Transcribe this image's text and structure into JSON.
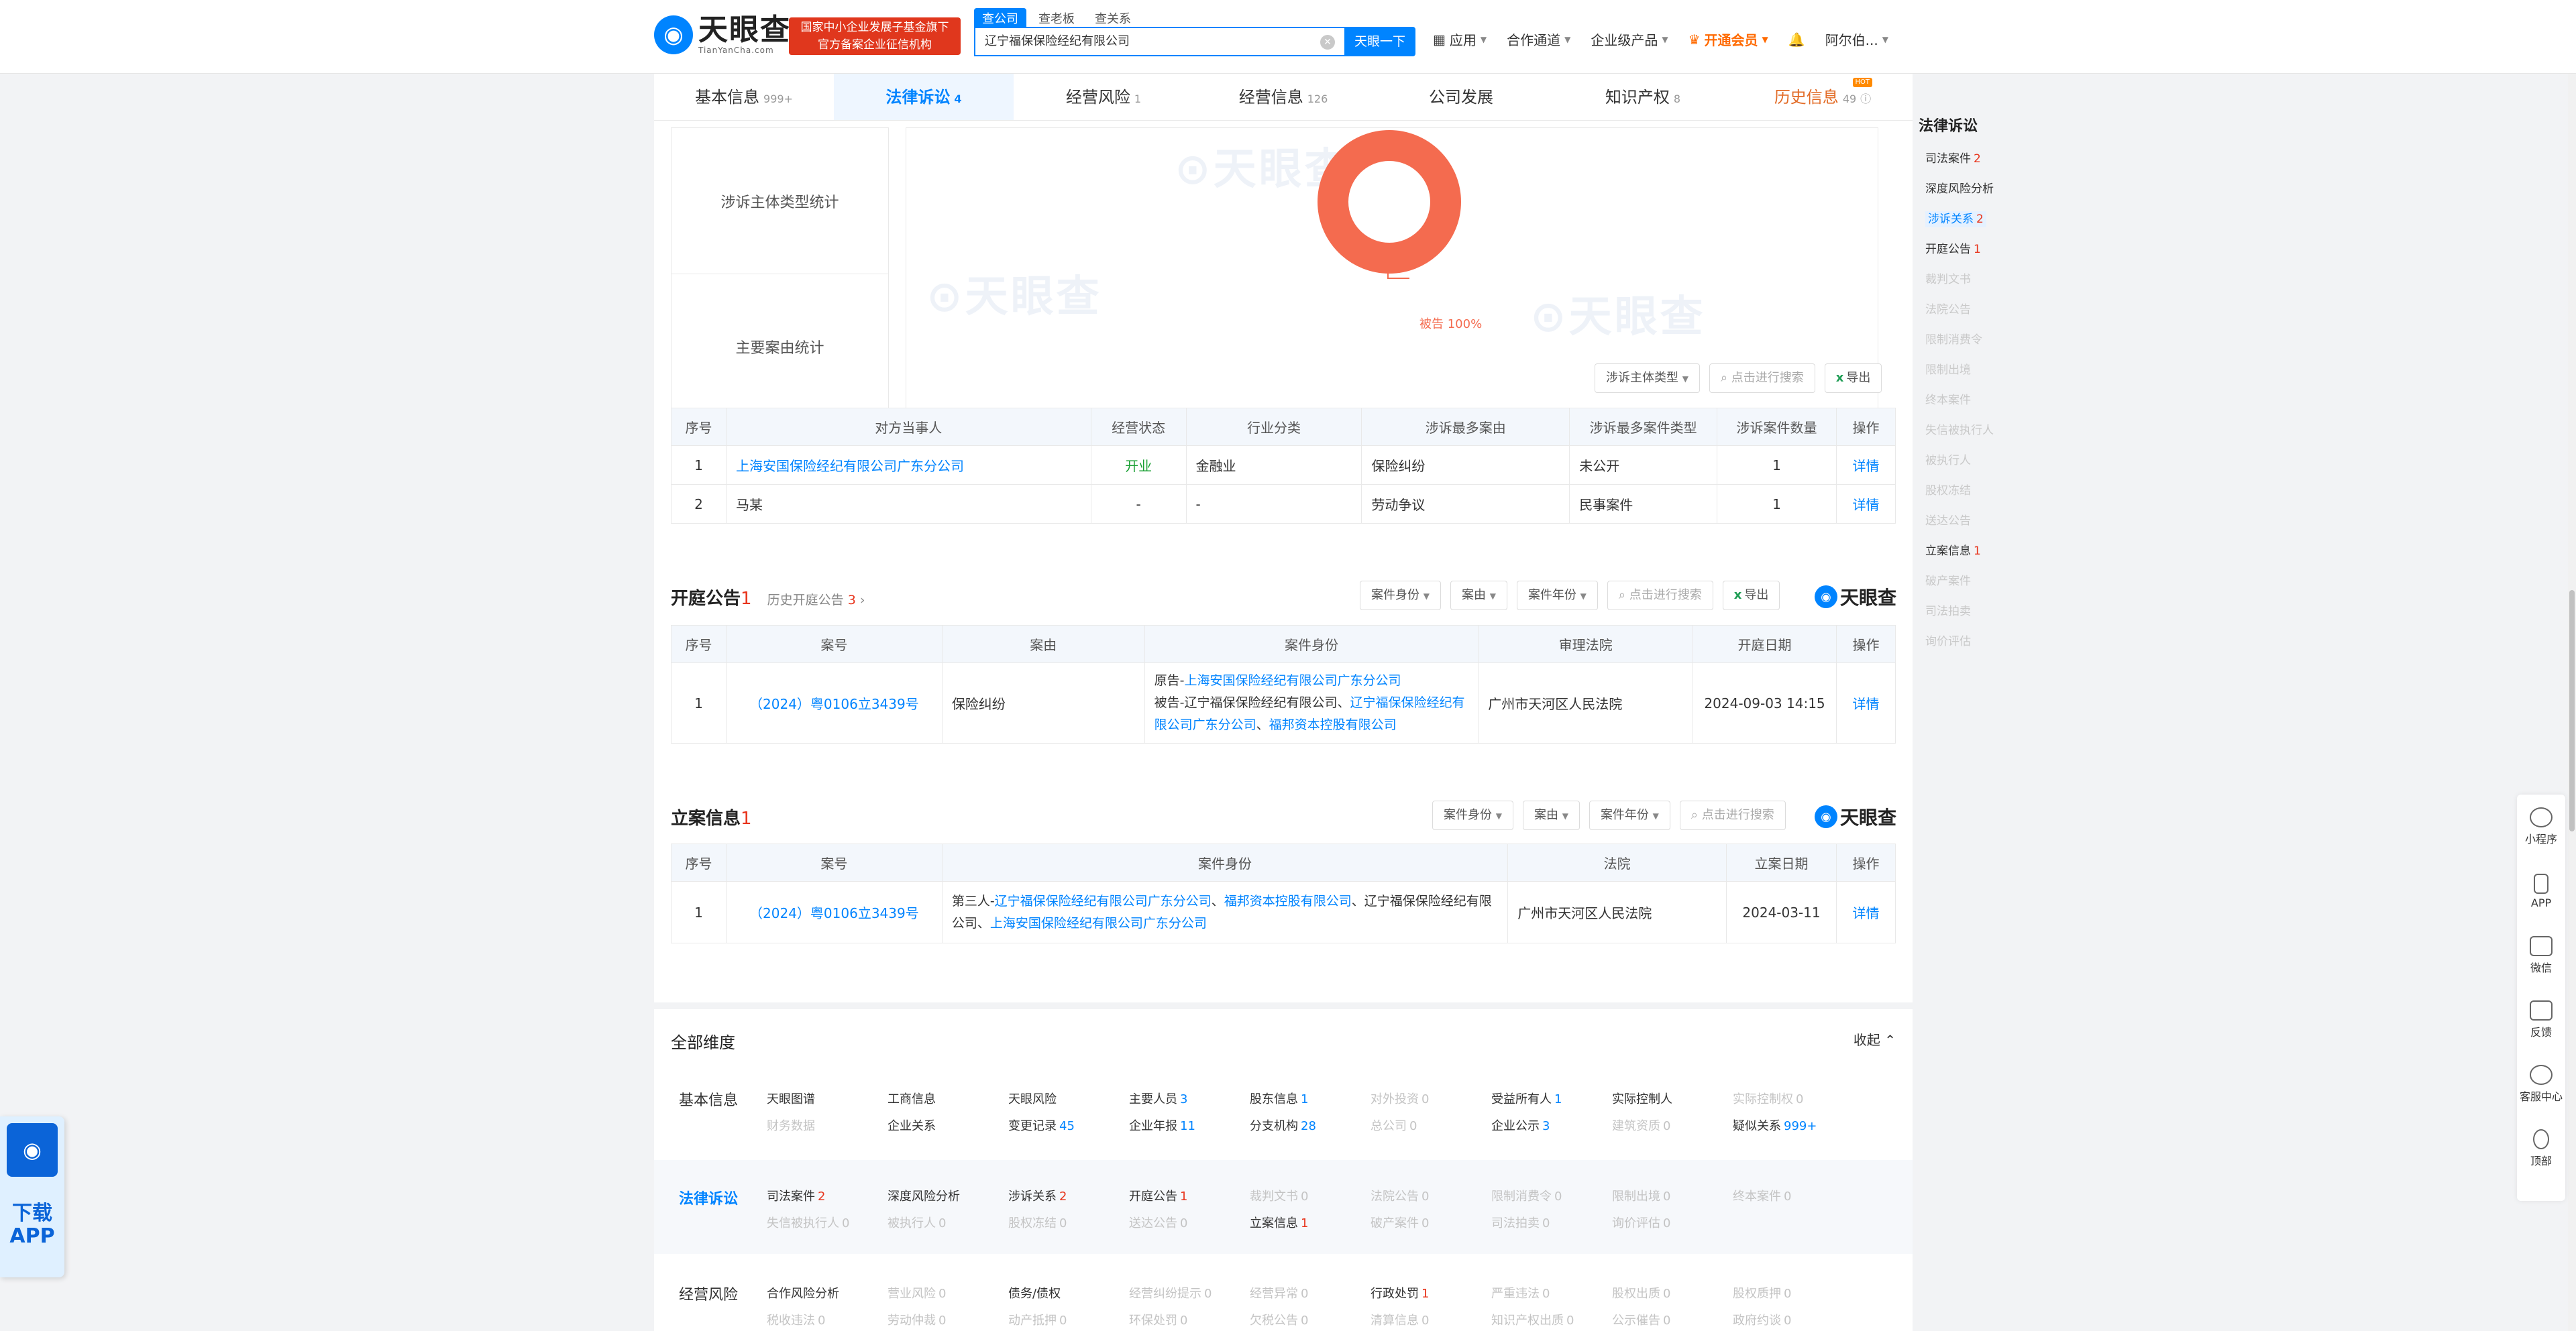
{
  "header": {
    "logo_cn": "天眼查",
    "logo_en": "TianYanCha.com",
    "gov_badge_line1": "国家中小企业发展子基金旗下",
    "gov_badge_line2": "官方备案企业征信机构",
    "search_tabs": [
      "查公司",
      "查老板",
      "查关系"
    ],
    "search_value": "辽宁福保保险经纪有限公司",
    "search_button": "天眼一下",
    "nav": [
      "应用",
      "合作通道",
      "企业级产品",
      "开通会员",
      "阿尔伯..."
    ]
  },
  "tabs": [
    {
      "label": "基本信息",
      "count": "999+"
    },
    {
      "label": "法律诉讼",
      "count": "4"
    },
    {
      "label": "经营风险",
      "count": "1"
    },
    {
      "label": "经营信息",
      "count": "126"
    },
    {
      "label": "公司发展",
      "count": ""
    },
    {
      "label": "知识产权",
      "count": "8"
    },
    {
      "label": "历史信息",
      "count": "49"
    }
  ],
  "stats": {
    "row1": "涉诉主体类型统计",
    "row2": "主要案由统计",
    "donut_label": "被告 100%",
    "watermark": "天眼查"
  },
  "related": {
    "toolbar": {
      "filter": "涉诉主体类型",
      "search": "点击进行搜索",
      "export": "导出"
    },
    "headers": [
      "序号",
      "对方当事人",
      "经营状态",
      "行业分类",
      "涉诉最多案由",
      "涉诉最多案件类型",
      "涉诉案件数量",
      "操作"
    ],
    "rows": [
      {
        "no": "1",
        "party": "上海安国保险经纪有限公司广东分公司",
        "status": "开业",
        "industry": "金融业",
        "cause": "保险纠纷",
        "type": "未公开",
        "count": "1",
        "op": "详情"
      },
      {
        "no": "2",
        "party": "马某",
        "status": "-",
        "industry": "-",
        "cause": "劳动争议",
        "type": "民事案件",
        "count": "1",
        "op": "详情"
      }
    ]
  },
  "hearing": {
    "title": "开庭公告",
    "count": "1",
    "history_label": "历史开庭公告",
    "history_count": "3",
    "toolbar": {
      "f1": "案件身份",
      "f2": "案由",
      "f3": "案件年份",
      "search": "点击进行搜索",
      "export": "导出"
    },
    "brand": "天眼查",
    "headers": [
      "序号",
      "案号",
      "案由",
      "案件身份",
      "审理法院",
      "开庭日期",
      "操作"
    ],
    "rows": [
      {
        "no": "1",
        "case_no": "（2024）粤0106立3439号",
        "cause": "保险纠纷",
        "role_plaintiff_prefix": "原告-",
        "role_plaintiff": "上海安国保险经纪有限公司广东分公司",
        "role_defendant_prefix": "被告-辽宁福保保险经纪有限公司、",
        "role_defendant_a": "辽宁福保保险经纪有限公司广东分公司",
        "role_defendant_sep": "、",
        "role_defendant_b": "福邦资本控股有限公司",
        "court": "广州市天河区人民法院",
        "date": "2024-09-03 14:15",
        "op": "详情"
      }
    ]
  },
  "filing": {
    "title": "立案信息",
    "count": "1",
    "toolbar": {
      "f1": "案件身份",
      "f2": "案由",
      "f3": "案件年份",
      "search": "点击进行搜索"
    },
    "brand": "天眼查",
    "headers": [
      "序号",
      "案号",
      "案件身份",
      "法院",
      "立案日期",
      "操作"
    ],
    "rows": [
      {
        "no": "1",
        "case_no": "（2024）粤0106立3439号",
        "role_prefix": "第三人-",
        "role_a": "辽宁福保保险经纪有限公司广东分公司",
        "sep1": "、",
        "role_b": "福邦资本控股有限公司",
        "role_c": "、辽宁福保保险经纪有限公司、",
        "role_d": "上海安国保险经纪有限公司广东分公司",
        "court": "广州市天河区人民法院",
        "date": "2024-03-11",
        "op": "详情"
      }
    ]
  },
  "dims": {
    "title": "全部维度",
    "collapse": "收起",
    "groups": [
      {
        "label": "基本信息",
        "items": [
          [
            "天眼图谱",
            "",
            "n"
          ],
          [
            "工商信息",
            "",
            "n"
          ],
          [
            "天眼风险",
            "",
            "n"
          ],
          [
            "主要人员",
            "3",
            "n"
          ],
          [
            "股东信息",
            "1",
            "n"
          ],
          [
            "对外投资",
            "0",
            "d"
          ],
          [
            "受益所有人",
            "1",
            "n"
          ],
          [
            "实际控制人",
            "",
            "n"
          ],
          [
            "实际控制权",
            "0",
            "d"
          ],
          [
            "财务数据",
            "",
            "d"
          ],
          [
            "企业关系",
            "",
            "n"
          ],
          [
            "变更记录",
            "45",
            "n"
          ],
          [
            "企业年报",
            "11",
            "n"
          ],
          [
            "分支机构",
            "28",
            "n"
          ],
          [
            "总公司",
            "0",
            "d"
          ],
          [
            "企业公示",
            "3",
            "n"
          ],
          [
            "建筑资质",
            "0",
            "d"
          ],
          [
            "疑似关系",
            "999+",
            "n"
          ]
        ]
      },
      {
        "label": "法律诉讼",
        "items": [
          [
            "司法案件",
            "2",
            "r"
          ],
          [
            "深度风险分析",
            "",
            "n"
          ],
          [
            "涉诉关系",
            "2",
            "r"
          ],
          [
            "开庭公告",
            "1",
            "r"
          ],
          [
            "裁判文书",
            "0",
            "d"
          ],
          [
            "法院公告",
            "0",
            "d"
          ],
          [
            "限制消费令",
            "0",
            "d"
          ],
          [
            "限制出境",
            "0",
            "d"
          ],
          [
            "终本案件",
            "0",
            "d"
          ],
          [
            "失信被执行人",
            "0",
            "d"
          ],
          [
            "被执行人",
            "0",
            "d"
          ],
          [
            "股权冻结",
            "0",
            "d"
          ],
          [
            "送达公告",
            "0",
            "d"
          ],
          [
            "立案信息",
            "1",
            "r"
          ],
          [
            "破产案件",
            "0",
            "d"
          ],
          [
            "司法拍卖",
            "0",
            "d"
          ],
          [
            "询价评估",
            "0",
            "d"
          ]
        ]
      },
      {
        "label": "经营风险",
        "items": [
          [
            "合作风险分析",
            "",
            "n"
          ],
          [
            "营业风险",
            "0",
            "d"
          ],
          [
            "债务/债权",
            "",
            "n"
          ],
          [
            "经营纠纷提示",
            "0",
            "d"
          ],
          [
            "经营异常",
            "0",
            "d"
          ],
          [
            "行政处罚",
            "1",
            "r"
          ],
          [
            "严重违法",
            "0",
            "d"
          ],
          [
            "股权出质",
            "0",
            "d"
          ],
          [
            "股权质押",
            "0",
            "d"
          ],
          [
            "税收违法",
            "0",
            "d"
          ],
          [
            "劳动仲裁",
            "0",
            "d"
          ],
          [
            "动产抵押",
            "0",
            "d"
          ],
          [
            "环保处罚",
            "0",
            "d"
          ],
          [
            "欠税公告",
            "0",
            "d"
          ],
          [
            "清算信息",
            "0",
            "d"
          ],
          [
            "知识产权出质",
            "0",
            "d"
          ],
          [
            "公示催告",
            "0",
            "d"
          ],
          [
            "政府约谈",
            "0",
            "d"
          ]
        ]
      }
    ]
  },
  "side_nav": {
    "title": "法律诉讼",
    "items": [
      [
        "司法案件",
        "2",
        "n"
      ],
      [
        "深度风险分析",
        "",
        "n"
      ],
      [
        "涉诉关系",
        "2",
        "a"
      ],
      [
        "开庭公告",
        "1",
        "n"
      ],
      [
        "裁判文书",
        "",
        "d"
      ],
      [
        "法院公告",
        "",
        "d"
      ],
      [
        "限制消费令",
        "",
        "d"
      ],
      [
        "限制出境",
        "",
        "d"
      ],
      [
        "终本案件",
        "",
        "d"
      ],
      [
        "失信被执行人",
        "",
        "d"
      ],
      [
        "被执行人",
        "",
        "d"
      ],
      [
        "股权冻结",
        "",
        "d"
      ],
      [
        "送达公告",
        "",
        "d"
      ],
      [
        "立案信息",
        "1",
        "n"
      ],
      [
        "破产案件",
        "",
        "d"
      ],
      [
        "司法拍卖",
        "",
        "d"
      ],
      [
        "询价评估",
        "",
        "d"
      ]
    ]
  },
  "float_bar": [
    "小程序",
    "APP",
    "微信",
    "反馈",
    "客服中心",
    "顶部"
  ],
  "app_widget": {
    "line1": "下载",
    "line2": "APP"
  },
  "colors": {
    "brand_blue": "#0084ff",
    "red": "#e8341c",
    "donut": "#f46b4f",
    "open_green": "#1aa034"
  }
}
